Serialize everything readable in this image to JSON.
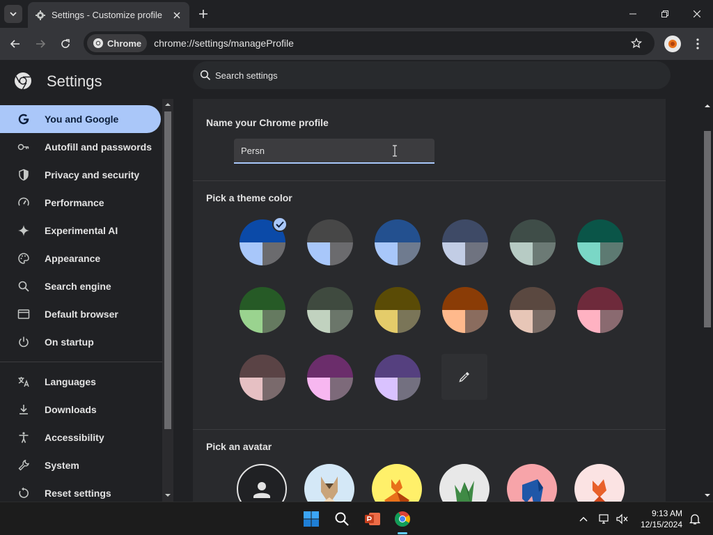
{
  "browser": {
    "tab_title": "Settings - Customize profile",
    "chip_label": "Chrome",
    "url": "chrome://settings/manageProfile"
  },
  "settings": {
    "title": "Settings",
    "search_placeholder": "Search settings"
  },
  "sidebar": {
    "items": [
      {
        "label": "You and Google",
        "icon": "google-icon",
        "active": true
      },
      {
        "label": "Autofill and passwords",
        "icon": "key-icon"
      },
      {
        "label": "Privacy and security",
        "icon": "shield-icon"
      },
      {
        "label": "Performance",
        "icon": "speedometer-icon"
      },
      {
        "label": "Experimental AI",
        "icon": "sparkle-icon"
      },
      {
        "label": "Appearance",
        "icon": "palette-icon"
      },
      {
        "label": "Search engine",
        "icon": "search-icon"
      },
      {
        "label": "Default browser",
        "icon": "browser-window-icon"
      },
      {
        "label": "On startup",
        "icon": "power-icon"
      },
      {
        "label": "Languages",
        "icon": "translate-icon"
      },
      {
        "label": "Downloads",
        "icon": "download-icon"
      },
      {
        "label": "Accessibility",
        "icon": "accessibility-icon"
      },
      {
        "label": "System",
        "icon": "wrench-icon"
      },
      {
        "label": "Reset settings",
        "icon": "reset-icon"
      }
    ]
  },
  "profile": {
    "name_heading": "Name your Chrome profile",
    "name_value": "Persn",
    "theme_heading": "Pick a theme color",
    "avatar_heading": "Pick an avatar",
    "selected_theme_index": 0,
    "theme_colors": [
      {
        "top": "#0b4aa8",
        "bl": "#a8c7fa",
        "br": "#6b6b6e"
      },
      {
        "top": "#474747",
        "bl": "#a8c7fa",
        "br": "#6b6b6e"
      },
      {
        "top": "#23508f",
        "bl": "#a8c7fa",
        "br": "#6f7b8f"
      },
      {
        "top": "#3e4a66",
        "bl": "#c2cde5",
        "br": "#6f7380"
      },
      {
        "top": "#3f4d48",
        "bl": "#b7cbc4",
        "br": "#6c7a75"
      },
      {
        "top": "#0a5548",
        "bl": "#7ad7c6",
        "br": "#5d7a72"
      },
      {
        "top": "#265a26",
        "bl": "#9ad38f",
        "br": "#657a60"
      },
      {
        "top": "#3f4a3f",
        "bl": "#c1d2bf",
        "br": "#6b766a"
      },
      {
        "top": "#5a4b06",
        "bl": "#e4cc6a",
        "br": "#7a7558"
      },
      {
        "top": "#8a3c06",
        "bl": "#ffb98c",
        "br": "#8a6c5e"
      },
      {
        "top": "#5a4840",
        "bl": "#e7c6b7",
        "br": "#7a6c66"
      },
      {
        "top": "#6e2a3b",
        "bl": "#ffb2c2",
        "br": "#8a6a70"
      },
      {
        "top": "#5a4345",
        "bl": "#e6c0c3",
        "br": "#7a6a6c"
      },
      {
        "top": "#6b2d6b",
        "bl": "#f7b7f0",
        "br": "#7d6a7a"
      },
      {
        "top": "#55407f",
        "bl": "#d9c2ff",
        "br": "#737080"
      }
    ],
    "picker_icon": "eyedropper-icon",
    "avatars": [
      {
        "name": "default-person-avatar",
        "bg": "#202124"
      },
      {
        "name": "origami-cat-avatar",
        "bg": "#d4e8f7"
      },
      {
        "name": "origami-fox-avatar",
        "bg": "#fff06a"
      },
      {
        "name": "origami-dragon-avatar",
        "bg": "#e8e8e8"
      },
      {
        "name": "origami-elephant-avatar",
        "bg": "#f7a4a9"
      },
      {
        "name": "origami-fox-red-avatar",
        "bg": "#fbe3e3"
      }
    ]
  },
  "taskbar": {
    "time": "9:13 AM",
    "date": "12/15/2024"
  }
}
